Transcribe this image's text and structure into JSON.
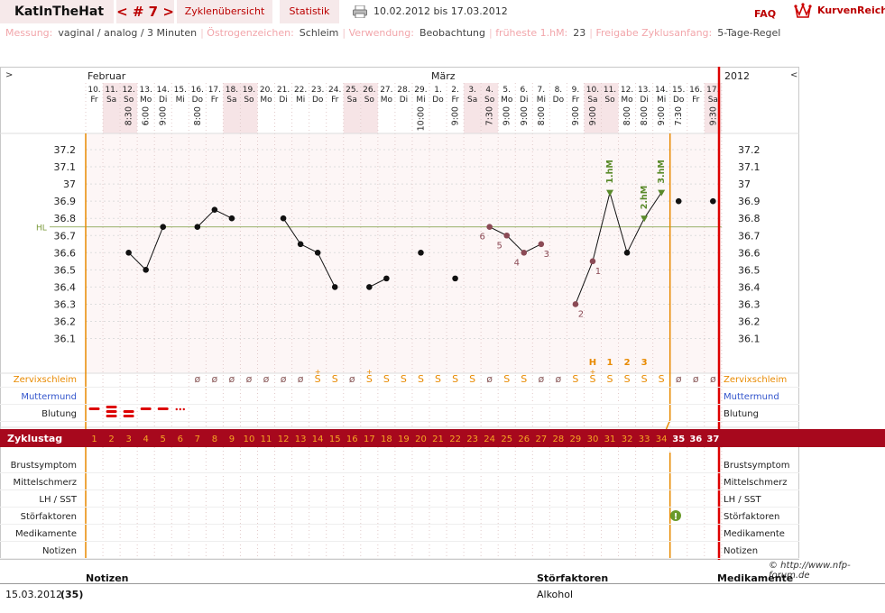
{
  "header": {
    "title": "KatInTheHat",
    "cycle_nav": "< # 7 >",
    "tab_overview": "Zyklenübersicht",
    "tab_stats": "Statistik",
    "date_range": "10.02.2012 bis 17.03.2012",
    "faq": "FAQ",
    "brand": "KurvenReich",
    "print_icon": "printer-icon"
  },
  "meta": {
    "messung_label": "Messung:",
    "messung_value": "vaginal / analog / 3 Minuten",
    "oestro_label": "Östrogenzeichen:",
    "oestro_value": "Schleim",
    "verw_label": "Verwendung:",
    "verw_value": "Beobachtung",
    "frueh_label": "früheste 1.hM:",
    "frueh_value": "23",
    "freigabe_label": "Freigabe Zyklusanfang:",
    "freigabe_value": "5-Tage-Regel"
  },
  "chart_data": {
    "type": "line",
    "nav_prev": ">",
    "nav_next": "<",
    "month1": "Februar",
    "month2": "März",
    "year": "2012",
    "hl_label": "HL",
    "hl_value": 36.75,
    "ylim": [
      36.0,
      37.3
    ],
    "yticks": [
      "37.2",
      "37.1",
      "37",
      "36.9",
      "36.8",
      "36.7",
      "36.6",
      "36.5",
      "36.4",
      "36.3",
      "36.2",
      "36.1"
    ],
    "dates": [
      "10.",
      "11.",
      "12.",
      "13.",
      "14.",
      "15.",
      "16.",
      "17.",
      "18.",
      "19.",
      "20.",
      "21.",
      "22.",
      "23.",
      "24.",
      "25.",
      "26.",
      "27.",
      "28.",
      "29.",
      "1.",
      "2.",
      "3.",
      "4.",
      "5.",
      "6.",
      "7.",
      "8.",
      "9.",
      "10.",
      "11.",
      "12.",
      "13.",
      "14.",
      "15.",
      "16.",
      "17."
    ],
    "weekdays": [
      "Fr",
      "Sa",
      "So",
      "Mo",
      "Di",
      "Mi",
      "Do",
      "Fr",
      "Sa",
      "So",
      "Mo",
      "Di",
      "Mi",
      "Do",
      "Fr",
      "Sa",
      "So",
      "Mo",
      "Di",
      "Mi",
      "Do",
      "Fr",
      "Sa",
      "So",
      "Mo",
      "Di",
      "Mi",
      "Do",
      "Fr",
      "Sa",
      "So",
      "Mo",
      "Di",
      "Mi",
      "Do",
      "Fr",
      "Sa"
    ],
    "times": [
      "",
      "",
      "8:30",
      "6:00",
      "9:00",
      "",
      "8:00",
      "",
      "",
      "",
      "",
      "",
      "",
      "",
      "",
      "",
      "",
      "",
      "",
      "10:00",
      "",
      "9:00",
      "",
      "7:30",
      "9:00",
      "9:00",
      "8:00",
      "",
      "9:00",
      "9:00",
      "",
      "8:00",
      "8:00",
      "9:00",
      "7:30",
      "",
      "9:30"
    ],
    "temps": [
      null,
      null,
      36.6,
      36.5,
      36.75,
      null,
      36.75,
      36.85,
      36.8,
      null,
      null,
      36.8,
      36.65,
      36.6,
      36.4,
      null,
      36.4,
      36.45,
      null,
      36.6,
      null,
      36.45,
      null,
      36.75,
      36.7,
      36.6,
      36.65,
      null,
      36.3,
      36.55,
      36.95,
      36.6,
      36.8,
      36.95,
      36.9,
      null,
      36.9
    ],
    "point_labels": {
      "23": "6",
      "24": "5",
      "25": "4",
      "26": "3",
      "28": "2",
      "29": "1"
    },
    "hm_labels": [
      {
        "day": 30,
        "text": "1.hM"
      },
      {
        "day": 32,
        "text": "2.hM"
      },
      {
        "day": 33,
        "text": "3.hM"
      }
    ],
    "peak_labels": [
      {
        "day": 29,
        "text": "H"
      },
      {
        "day": 30,
        "text": "1"
      },
      {
        "day": 31,
        "text": "2"
      },
      {
        "day": 32,
        "text": "3"
      }
    ],
    "mucus": [
      "",
      "",
      "",
      "",
      "",
      "",
      "ø",
      "ø",
      "ø",
      "ø",
      "ø",
      "ø",
      "ø",
      "S",
      "S",
      "ø",
      "S",
      "S",
      "S",
      "S",
      "S",
      "S",
      "S",
      "ø",
      "S",
      "S",
      "ø",
      "ø",
      "S",
      "S",
      "S",
      "S",
      "S",
      "S",
      "ø",
      "ø",
      "ø"
    ],
    "mucus_plus": [
      13,
      16,
      29
    ],
    "bleeding": [
      "line",
      "double",
      "double",
      "line",
      "line",
      "dots"
    ],
    "cycle_days": [
      "1",
      "2",
      "3",
      "4",
      "5",
      "6",
      "7",
      "8",
      "9",
      "10",
      "11",
      "12",
      "13",
      "14",
      "15",
      "16",
      "17",
      "18",
      "19",
      "20",
      "21",
      "22",
      "23",
      "24",
      "25",
      "26",
      "27",
      "28",
      "29",
      "30",
      "31",
      "32",
      "33",
      "34",
      "35",
      "36",
      "37"
    ],
    "stoer_day": 34
  },
  "rows": {
    "zervix": "Zervixschleim",
    "muttermund": "Muttermund",
    "blutung": "Blutung",
    "zyklustag": "Zyklustag",
    "brust": "Brustsymptom",
    "mittel": "Mittelschmerz",
    "lh": "LH / SST",
    "stoer": "Störfaktoren",
    "medi": "Medikamente",
    "notizen": "Notizen"
  },
  "footer": {
    "copyright": "© http://www.nfp-forum.de",
    "col_notizen": "Notizen",
    "col_stoer": "Störfaktoren",
    "col_medi": "Medikamente",
    "row_date": "15.03.2012",
    "row_day": "(35)",
    "row_stoer": "Alkohol"
  },
  "colors": {
    "accent": "#bb0000",
    "orange": "#e88a00",
    "point_pink": "#8b4a55",
    "hm_green": "#5a8a2a",
    "zyklus_bar": "#a7081d"
  }
}
